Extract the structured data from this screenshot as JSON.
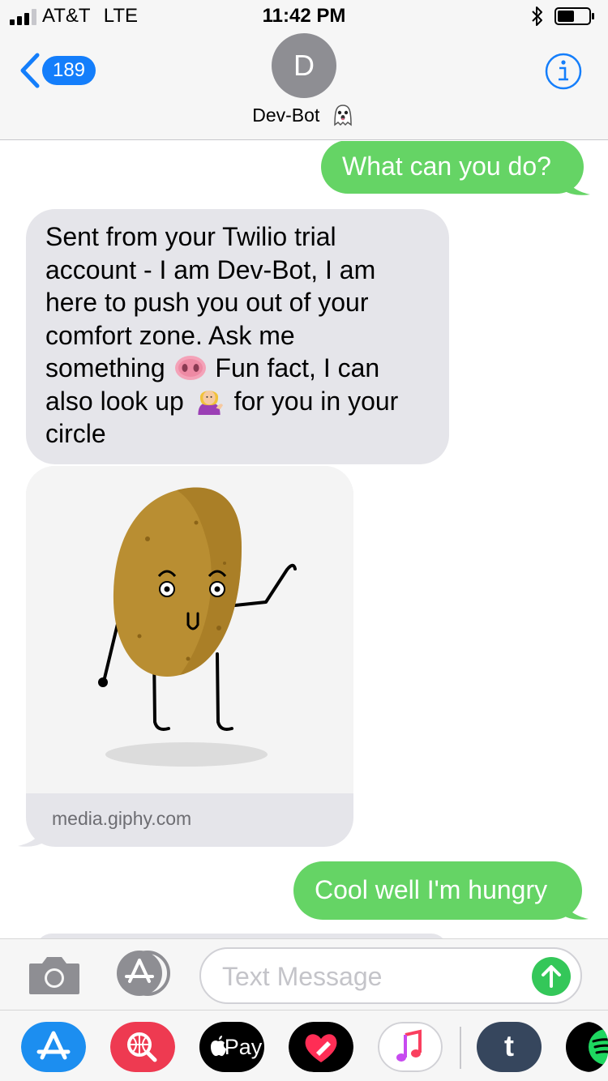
{
  "status_bar": {
    "carrier": "AT&T",
    "network": "LTE",
    "time": "11:42 PM",
    "bluetooth_icon": "bluetooth-icon",
    "battery_icon": "battery-icon"
  },
  "header": {
    "back_count": "189",
    "avatar_initial": "D",
    "contact_name": "Dev-Bot",
    "contact_emoji": "ghost-emoji",
    "info_icon": "info-icon"
  },
  "messages": [
    {
      "direction": "sent",
      "text": "What can you do?"
    },
    {
      "direction": "received",
      "lines": [
        {
          "text": "Sent from your Twilio trial"
        },
        {
          "text": "account - I am Dev-Bot, I am"
        },
        {
          "text": "here to push you out of your"
        },
        {
          "text": "comfort zone. Ask me"
        },
        {
          "before": "something ",
          "emoji": "pig-nose-emoji",
          "after": " Fun fact, I can"
        },
        {
          "before": "also look up ",
          "emoji": "tipping-hand-person-emoji",
          "after": " for you in your"
        },
        {
          "text": "circle"
        }
      ]
    },
    {
      "direction": "received",
      "type": "link_preview",
      "image": "waving-potato-gif",
      "domain": "media.giphy.com"
    },
    {
      "direction": "sent",
      "text": "Cool well I'm hungry"
    }
  ],
  "input_bar": {
    "placeholder": "Text Message",
    "camera_icon": "camera-icon",
    "appstore_icon": "app-store-icon",
    "send_icon": "send-arrow-icon"
  },
  "app_drawer": {
    "apps": [
      "app-store",
      "web-images-search",
      "apple-pay",
      "digital-touch",
      "music",
      "tumblr",
      "spotify"
    ],
    "apple_pay_label": "Pay",
    "tumblr_letter": "t"
  },
  "colors": {
    "sent_bubble": "#65d465",
    "received_bubble": "#e5e5ea",
    "ios_blue": "#147efb",
    "background": "#ffffff"
  }
}
